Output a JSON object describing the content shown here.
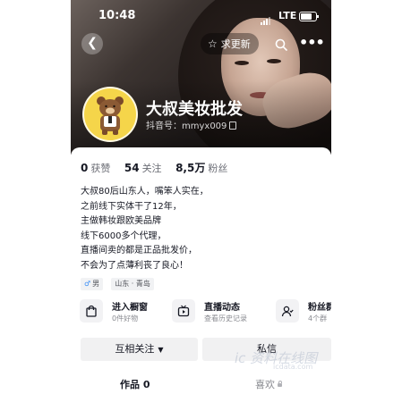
{
  "status_bar": {
    "time": "10:48",
    "network": "LTE"
  },
  "header": {
    "update_button_label": "求更新",
    "nickname": "大叔美妆批发",
    "douyin_id": "抖音号：mmyx009"
  },
  "stats": [
    {
      "value": "0",
      "label": "获赞"
    },
    {
      "value": "54",
      "label": "关注"
    },
    {
      "value": "8,5万",
      "label": "粉丝"
    }
  ],
  "bio": [
    "大叔80后山东人，嘴笨人实在，",
    "之前线下实体干了12年，",
    "主做韩妆跟欧美品牌",
    "线下6000多个代理，",
    "直播间卖的都是正品批发价，",
    "不会为了点薄利丧了良心！"
  ],
  "tags": {
    "gender": "男",
    "location": "山东 · 青岛"
  },
  "services": [
    {
      "title": "进入橱窗",
      "subtitle": "0件好物",
      "icon": "shopping-bag-icon"
    },
    {
      "title": "直播动态",
      "subtitle": "查看历史记录",
      "icon": "live-tv-icon"
    },
    {
      "title": "粉丝群",
      "subtitle": "4个群",
      "icon": "fans-group-icon"
    }
  ],
  "actions": {
    "follow_label": "互相关注",
    "message_label": "私信"
  },
  "tabs": {
    "works_label": "作品 0",
    "likes_label": "喜欢"
  },
  "watermark": {
    "main": "ic 资料在线图",
    "sub": "icdata.com"
  },
  "colors": {
    "avatar_bg": "#f5d54a",
    "male_icon": "#3a8ef6"
  }
}
